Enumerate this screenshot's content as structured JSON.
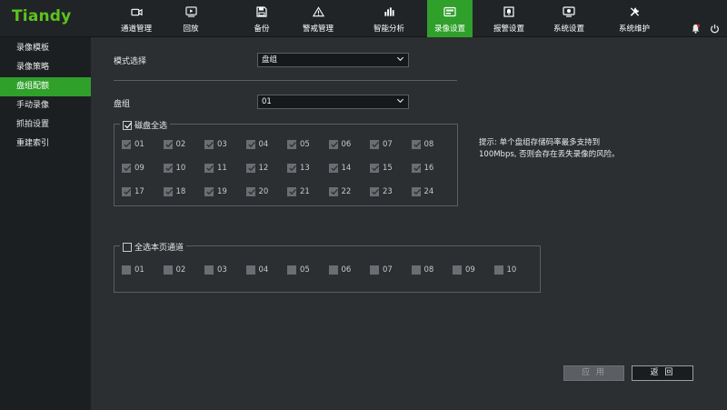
{
  "brand": {
    "logo_text": "Tiandy",
    "logo_color": "#5dc21e",
    "accent": "#2fa02a"
  },
  "nav": {
    "items": [
      {
        "label": "通道管理",
        "icon": "camera-icon"
      },
      {
        "label": "回放",
        "icon": "playback-icon"
      },
      {
        "label": "备份",
        "icon": "save-icon"
      },
      {
        "label": "警戒管理",
        "icon": "alert-icon"
      },
      {
        "label": "智能分析",
        "icon": "analytics-icon"
      },
      {
        "label": "录像设置",
        "icon": "record-settings-icon",
        "active": true
      },
      {
        "label": "报警设置",
        "icon": "alarm-settings-icon"
      },
      {
        "label": "系统设置",
        "icon": "system-settings-icon"
      },
      {
        "label": "系统维护",
        "icon": "maintenance-icon"
      }
    ],
    "right_icons": [
      "bell-icon",
      "power-icon"
    ]
  },
  "sidebar": {
    "items": [
      {
        "label": "录像模板"
      },
      {
        "label": "录像策略"
      },
      {
        "label": "盘组配额",
        "active": true
      },
      {
        "label": "手动录像"
      },
      {
        "label": "抓拍设置"
      },
      {
        "label": "重建索引"
      }
    ]
  },
  "form": {
    "mode_label": "模式选择",
    "mode_value": "盘组",
    "group_label": "盘组",
    "group_value": "01"
  },
  "disk_group": {
    "legend": "磁盘全选",
    "checked": true,
    "disks": [
      "01",
      "02",
      "03",
      "04",
      "05",
      "06",
      "07",
      "08",
      "09",
      "10",
      "11",
      "12",
      "13",
      "14",
      "15",
      "16",
      "17",
      "18",
      "19",
      "20",
      "21",
      "22",
      "23",
      "24"
    ]
  },
  "channel_group": {
    "legend": "全选本页通道",
    "checked": false,
    "channels": [
      "01",
      "02",
      "03",
      "04",
      "05",
      "06",
      "07",
      "08",
      "09",
      "10"
    ]
  },
  "hint": {
    "line1": "提示: 单个盘组存储码率最多支持到",
    "line2": "100Mbps, 否则会存在丢失录像的风险。"
  },
  "buttons": {
    "apply": "应 用",
    "back": "返 回"
  }
}
